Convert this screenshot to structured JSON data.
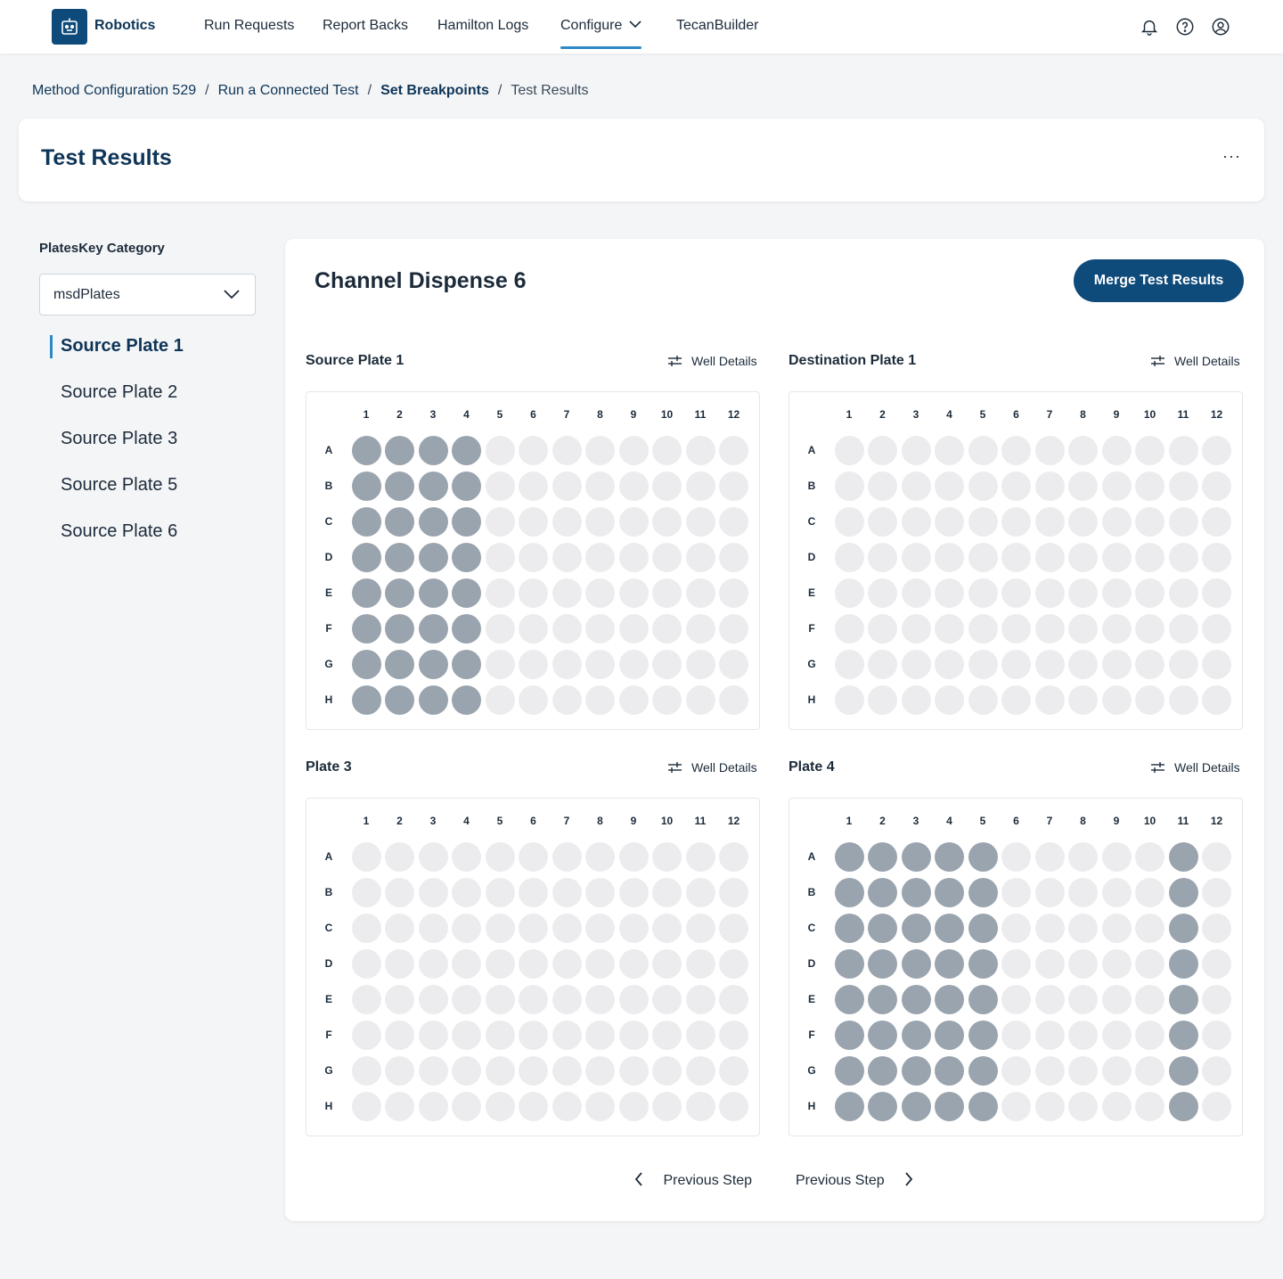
{
  "brand": "Robotics",
  "nav": {
    "items": [
      {
        "label": "Run Requests"
      },
      {
        "label": "Report Backs"
      },
      {
        "label": "Hamilton Logs"
      },
      {
        "label": "Configure"
      },
      {
        "label": "TecanBuilder"
      }
    ],
    "active": "Configure"
  },
  "breadcrumb": [
    {
      "label": "Method Configuration 529"
    },
    {
      "label": "Run a Connected Test"
    },
    {
      "label": "Set Breakpoints"
    },
    {
      "label": "Test Results"
    }
  ],
  "page_title": "Test Results",
  "more_label": "···",
  "sidebar": {
    "category_label": "PlatesKey Category",
    "select_value": "msdPlates",
    "items": [
      {
        "label": "Source Plate 1"
      },
      {
        "label": "Source Plate 2"
      },
      {
        "label": "Source Plate 3"
      },
      {
        "label": "Source Plate 5"
      },
      {
        "label": "Source Plate 6"
      }
    ],
    "active": "Source Plate 1"
  },
  "main": {
    "title": "Channel Dispense 6",
    "merge_label": "Merge Test Results",
    "well_details_label": "Well Details",
    "columns": [
      "1",
      "2",
      "3",
      "4",
      "5",
      "6",
      "7",
      "8",
      "9",
      "10",
      "11",
      "12"
    ],
    "rows": [
      "A",
      "B",
      "C",
      "D",
      "E",
      "F",
      "G",
      "H"
    ],
    "plates": [
      {
        "name": "Source Plate 1",
        "filled_columns": [
          1,
          2,
          3,
          4
        ]
      },
      {
        "name": "Destination Plate 1",
        "filled_columns": []
      },
      {
        "name": "Plate 3",
        "filled_columns": []
      },
      {
        "name": "Plate 4",
        "filled_columns": [
          1,
          2,
          3,
          4,
          5,
          11
        ]
      }
    ],
    "prev_label": "Previous Step",
    "next_label": "Previous Step"
  },
  "colors": {
    "primary": "#0e4a7a",
    "accent": "#2b8ac6",
    "well_filled": "#9aa4ae",
    "well_empty": "#ececee"
  }
}
